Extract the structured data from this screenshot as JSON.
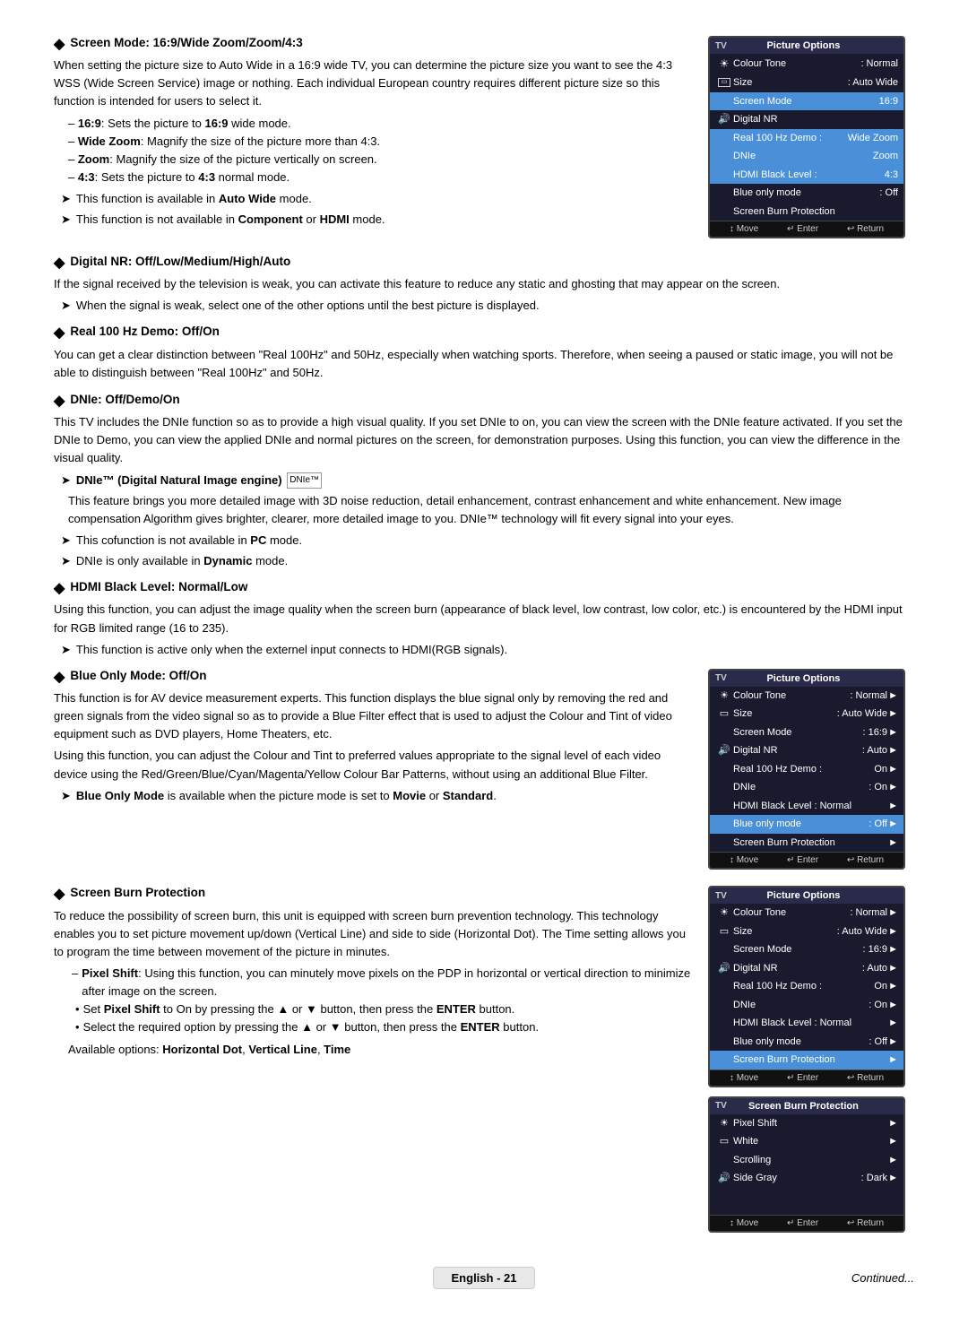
{
  "page": {
    "sections": [
      {
        "id": "screen-mode",
        "heading": "Screen Mode: 16:9/Wide Zoom/Zoom/4:3",
        "paragraphs": [
          "When setting the picture size to Auto Wide in a 16:9 wide TV, you can determine the picture size you want to see the 4:3 WSS (Wide Screen Service) image or nothing. Each individual European country requires different picture size so this function is intended for users to select it."
        ],
        "list": [
          "– 16:9: Sets the picture to 16:9 wide mode.",
          "– Wide Zoom: Magnify the size of the picture more than 4:3.",
          "– Zoom: Magnify the size of the picture vertically on screen.",
          "– 4:3: Sets the picture to 4:3 normal mode."
        ],
        "notes": [
          "This function is available in Auto Wide mode.",
          "This function is not available in Component or HDMI mode."
        ],
        "has_panel": true,
        "panel_index": 0
      },
      {
        "id": "digital-nr",
        "heading": "Digital NR: Off/Low/Medium/High/Auto",
        "paragraphs": [
          "If the signal received by the television is weak, you can activate this feature to reduce any static and ghosting that may appear on the screen."
        ],
        "notes": [
          "When the signal is weak, select one of the other options until the best picture is displayed."
        ]
      },
      {
        "id": "real-100hz",
        "heading": "Real 100 Hz Demo: Off/On",
        "paragraphs": [
          "You can get a clear distinction between \"Real 100Hz\" and 50Hz, especially when watching sports. Therefore, when seeing a paused or static image, you will not be able to distinguish between \"Real 100Hz\" and 50Hz."
        ]
      },
      {
        "id": "dnie",
        "heading": "DNIe: Off/Demo/On",
        "paragraphs": [
          "This TV includes the DNIe function so as to provide a high visual quality. If you set DNIe to on, you can view the screen with the DNIe feature activated. If you set the DNIe to Demo, you can view the applied DNIe and normal pictures on the screen, for demonstration purposes. Using this function, you can view the difference in the visual quality."
        ],
        "sub_heading": "DNIe™ (Digital Natural Image engine)",
        "sub_paragraphs": [
          "This feature brings you more detailed image with 3D noise reduction, detail enhancement, contrast enhancement and white enhancement. New image compensation Algorithm gives brighter, clearer, more detailed image to you. DNIe™ technology will fit every signal into your eyes."
        ],
        "sub_notes": [
          "This cofunction is not available in PC mode.",
          "DNIe is only available in Dynamic mode."
        ]
      },
      {
        "id": "hdmi-black",
        "heading": "HDMI Black Level: Normal/Low",
        "paragraphs": [
          "Using this function, you can adjust the image quality when the screen burn (appearance of black level, low contrast, low color, etc.) is encountered by the HDMI input for RGB limited range (16 to 235)."
        ],
        "notes": [
          "This function is active only when the externel input connects to HDMI(RGB signals)."
        ]
      },
      {
        "id": "blue-only",
        "heading": "Blue Only Mode: Off/On",
        "paragraphs": [
          "This function is for AV device measurement experts. This function displays the blue signal only by removing the red and green signals from the video signal so as to provide a Blue Filter effect that is used to adjust the Colour and Tint of video equipment such as DVD players, Home Theaters, etc.",
          "Using this function, you can adjust the Colour and Tint to preferred values appropriate to the signal level of each video device using the Red/Green/Blue/Cyan/Magenta/Yellow Colour Bar Patterns, without using an additional Blue Filter."
        ],
        "notes": [
          "Blue Only Mode is available when the picture mode is set to Movie or Standard."
        ],
        "has_panel": true,
        "panel_index": 1
      },
      {
        "id": "screen-burn",
        "heading": "Screen Burn Protection",
        "paragraphs": [
          "To reduce the possibility of screen burn, this unit is equipped with screen burn prevention technology. This technology enables you to set picture movement up/down (Vertical Line) and side to side (Horizontal Dot). The Time setting allows you to program the time between movement of the picture in minutes."
        ],
        "list2": [
          "– Pixel Shift: Using this function, you can minutely move pixels on the PDP in horizontal or vertical direction to minimize after image on the screen."
        ],
        "dot_list": [
          "Set Pixel Shift to On by pressing the ▲ or ▼ button, then press the ENTER button.",
          "Select the required option by pressing the ▲ or ▼ button, then press the ENTER button."
        ],
        "footer_text": "Available options: Horizontal Dot, Vertical Line, Time",
        "has_panel": true,
        "panel_index": 2
      }
    ],
    "panels": [
      {
        "title": "Picture Options",
        "tv_label": "TV",
        "rows": [
          {
            "icon": "picture",
            "label": "Colour Tone",
            "value": ": Normal",
            "highlighted": false,
            "dimmed": false
          },
          {
            "icon": "size",
            "label": "Size",
            "value": ": Auto Wide",
            "highlighted": false,
            "dimmed": false
          },
          {
            "icon": "",
            "label": "Screen Mode",
            "value": "16:9",
            "highlighted": true,
            "dimmed": false
          },
          {
            "icon": "nr",
            "label": "Digital NR",
            "value": "",
            "highlighted": false,
            "dimmed": false
          },
          {
            "icon": "",
            "label": "Real 100 Hz Demo :",
            "value": "Wide Zoom",
            "highlighted": true,
            "dimmed": false
          },
          {
            "icon": "",
            "label": "DNIe",
            "value": "Zoom",
            "highlighted": true,
            "dimmed": false
          },
          {
            "icon": "",
            "label": "HDMI Black Level :",
            "value": "4:3",
            "highlighted": true,
            "dimmed": false
          },
          {
            "icon": "",
            "label": "Blue only mode",
            "value": ": Off",
            "highlighted": false,
            "dimmed": false
          },
          {
            "icon": "",
            "label": "Screen Burn Protection",
            "value": "",
            "highlighted": false,
            "dimmed": false
          }
        ],
        "footer": [
          "↕ Move",
          "↵ Enter",
          "↩ Return"
        ]
      },
      {
        "title": "Picture Options",
        "tv_label": "TV",
        "rows": [
          {
            "icon": "picture",
            "label": "Colour Tone",
            "value": ": Normal",
            "arrow": "►"
          },
          {
            "icon": "size",
            "label": "Size",
            "value": ": Auto Wide",
            "arrow": "►"
          },
          {
            "icon": "",
            "label": "Screen Mode",
            "value": ": 16:9",
            "arrow": "►"
          },
          {
            "icon": "nr",
            "label": "Digital NR",
            "value": ": Auto",
            "arrow": "►"
          },
          {
            "icon": "",
            "label": "Real 100 Hz Demo :",
            "value": "On",
            "arrow": "►"
          },
          {
            "icon": "",
            "label": "DNIe",
            "value": ": On",
            "arrow": "►"
          },
          {
            "icon": "",
            "label": "HDMI Black Level : Normal",
            "value": "",
            "arrow": "►"
          },
          {
            "icon": "",
            "label": "Blue only mode",
            "value": ": Off",
            "highlighted": true,
            "arrow": "►"
          },
          {
            "icon": "",
            "label": "Screen Burn Protection",
            "value": "",
            "arrow": "►"
          }
        ],
        "footer": [
          "↕ Move",
          "↵ Enter",
          "↩ Return"
        ]
      },
      {
        "title": "Screen Burn Protection",
        "tv_label": "TV",
        "rows": [
          {
            "icon": "picture",
            "label": "Pixel Shift",
            "value": "",
            "arrow": "►"
          },
          {
            "icon": "size",
            "label": "White",
            "value": "",
            "arrow": "►"
          },
          {
            "icon": "",
            "label": "Scrolling",
            "value": "",
            "arrow": "►"
          },
          {
            "icon": "nr",
            "label": "Side Gray",
            "value": ": Dark",
            "arrow": "►"
          }
        ],
        "footer": [
          "↕ Move",
          "↵ Enter",
          "↩ Return"
        ]
      }
    ],
    "footer": {
      "english_label": "English - 21",
      "continued_label": "Continued..."
    }
  }
}
